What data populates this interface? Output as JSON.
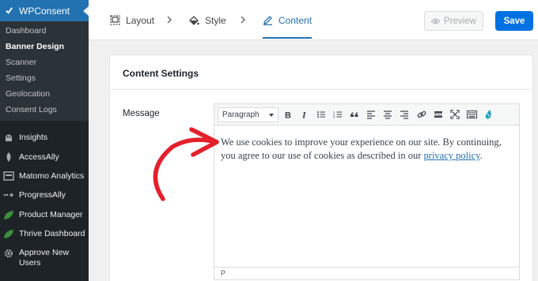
{
  "sidebar": {
    "brand_label": "WPConsent",
    "submenu": [
      {
        "label": "Dashboard",
        "active": false
      },
      {
        "label": "Banner Design",
        "active": true
      },
      {
        "label": "Scanner",
        "active": false
      },
      {
        "label": "Settings",
        "active": false
      },
      {
        "label": "Geolocation",
        "active": false
      },
      {
        "label": "Consent Logs",
        "active": false
      }
    ],
    "menu": [
      {
        "label": "Insights",
        "icon": "insights-icon"
      },
      {
        "label": "AccessAlly",
        "icon": "accessally-icon"
      },
      {
        "label": "Matomo Analytics",
        "icon": "matomo-icon"
      },
      {
        "label": "ProgressAlly",
        "icon": "progressally-icon"
      },
      {
        "label": "Product Manager",
        "icon": "leaf-icon"
      },
      {
        "label": "Thrive Dashboard",
        "icon": "leaf-icon"
      },
      {
        "label": "Approve New Users",
        "icon": "gear-icon"
      }
    ]
  },
  "tabs": [
    {
      "label": "Layout",
      "icon": "layout-icon",
      "active": false
    },
    {
      "label": "Style",
      "icon": "paint-bucket-icon",
      "active": false
    },
    {
      "label": "Content",
      "icon": "pencil-icon",
      "active": true
    }
  ],
  "actions": {
    "preview_label": "Preview",
    "save_label": "Save"
  },
  "card": {
    "title": "Content Settings",
    "field_label": "Message",
    "editor": {
      "format_value": "Paragraph",
      "message_text": "We use cookies to improve your experience on our site. By continuing, you agree to our use of cookies as described in our ",
      "link_text": "privacy policy",
      "message_end": ".",
      "status_path": "P"
    }
  },
  "colors": {
    "accent": "#2271b1",
    "save": "#0071e3",
    "annotation": "#e4202b"
  }
}
